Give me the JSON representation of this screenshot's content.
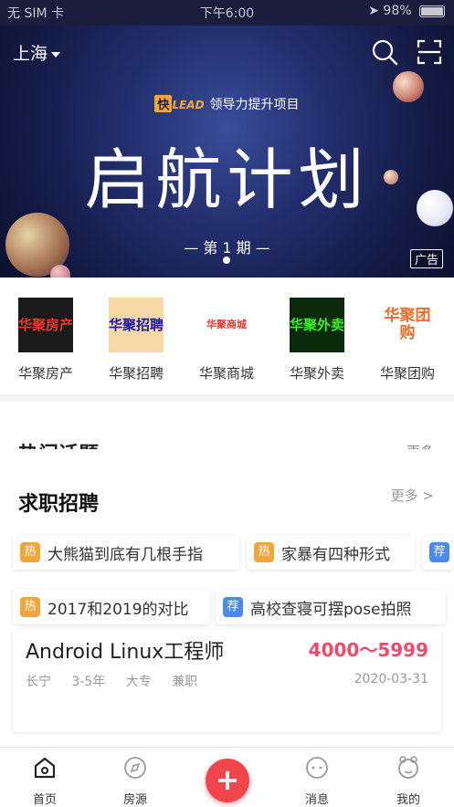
{
  "status_bar": {
    "carrier": "无 SIM 卡",
    "time": "下午6:00",
    "battery": "98%",
    "battery_level": 0.98
  },
  "banner": {
    "city": "上海",
    "logo_badge": "快",
    "logo_lead": "LEAD",
    "subtitle": "领导力提升项目",
    "title": "启航计划",
    "period": "— 第 1 期 —",
    "ad_label": "广告",
    "colors": {
      "accent": "#f2a53a",
      "background": "#1a1e3c"
    }
  },
  "categories": [
    {
      "name": "华聚房产",
      "img_text": "华聚房产",
      "img_bg": "#1a1a1a",
      "img_color": "#e8382c"
    },
    {
      "name": "华聚招聘",
      "img_text": "华聚招聘",
      "img_bg": "#f6d7a6",
      "img_color": "#1a1aa0"
    },
    {
      "name": "华聚商城",
      "img_text": "华聚商城",
      "img_bg": "#ffffff",
      "img_color": "#e8382c"
    },
    {
      "name": "华聚外卖",
      "img_text": "华聚外卖",
      "img_bg": "#0a2a0a",
      "img_color": "#3df02a"
    },
    {
      "name": "华聚团购",
      "img_text": "华聚团购",
      "img_bg": "#ffffff",
      "img_color": "#f26a2a"
    }
  ],
  "hot_topics": {
    "title": "热门话题",
    "more": "更多"
  },
  "jobs": {
    "title": "求职招聘",
    "more": "更多 >",
    "chips": [
      {
        "tag": "热",
        "type": "hot",
        "text": "大熊猫到底有几根手指"
      },
      {
        "tag": "热",
        "type": "hot",
        "text": "家暴有四种形式"
      },
      {
        "tag": "荐",
        "type": "rec",
        "text": ""
      },
      {
        "tag": "热",
        "type": "hot",
        "text": "2017和2019的对比"
      },
      {
        "tag": "荐",
        "type": "rec",
        "text": "高校查寝可摆pose拍照"
      }
    ],
    "card": {
      "title": "Android Linux工程师",
      "salary": "4000～5999",
      "district": "长宁",
      "experience": "3-5年",
      "education": "大专",
      "job_type": "兼职",
      "date": "2020-03-31"
    }
  },
  "tabbar": {
    "items": [
      {
        "label": "首页",
        "icon": "home-icon"
      },
      {
        "label": "房源",
        "icon": "compass-icon"
      },
      {
        "label": "",
        "icon": "plus-icon"
      },
      {
        "label": "消息",
        "icon": "message-icon"
      },
      {
        "label": "我的",
        "icon": "profile-icon"
      }
    ],
    "fab_glyph": "+",
    "fab_color": "#f0454a"
  }
}
